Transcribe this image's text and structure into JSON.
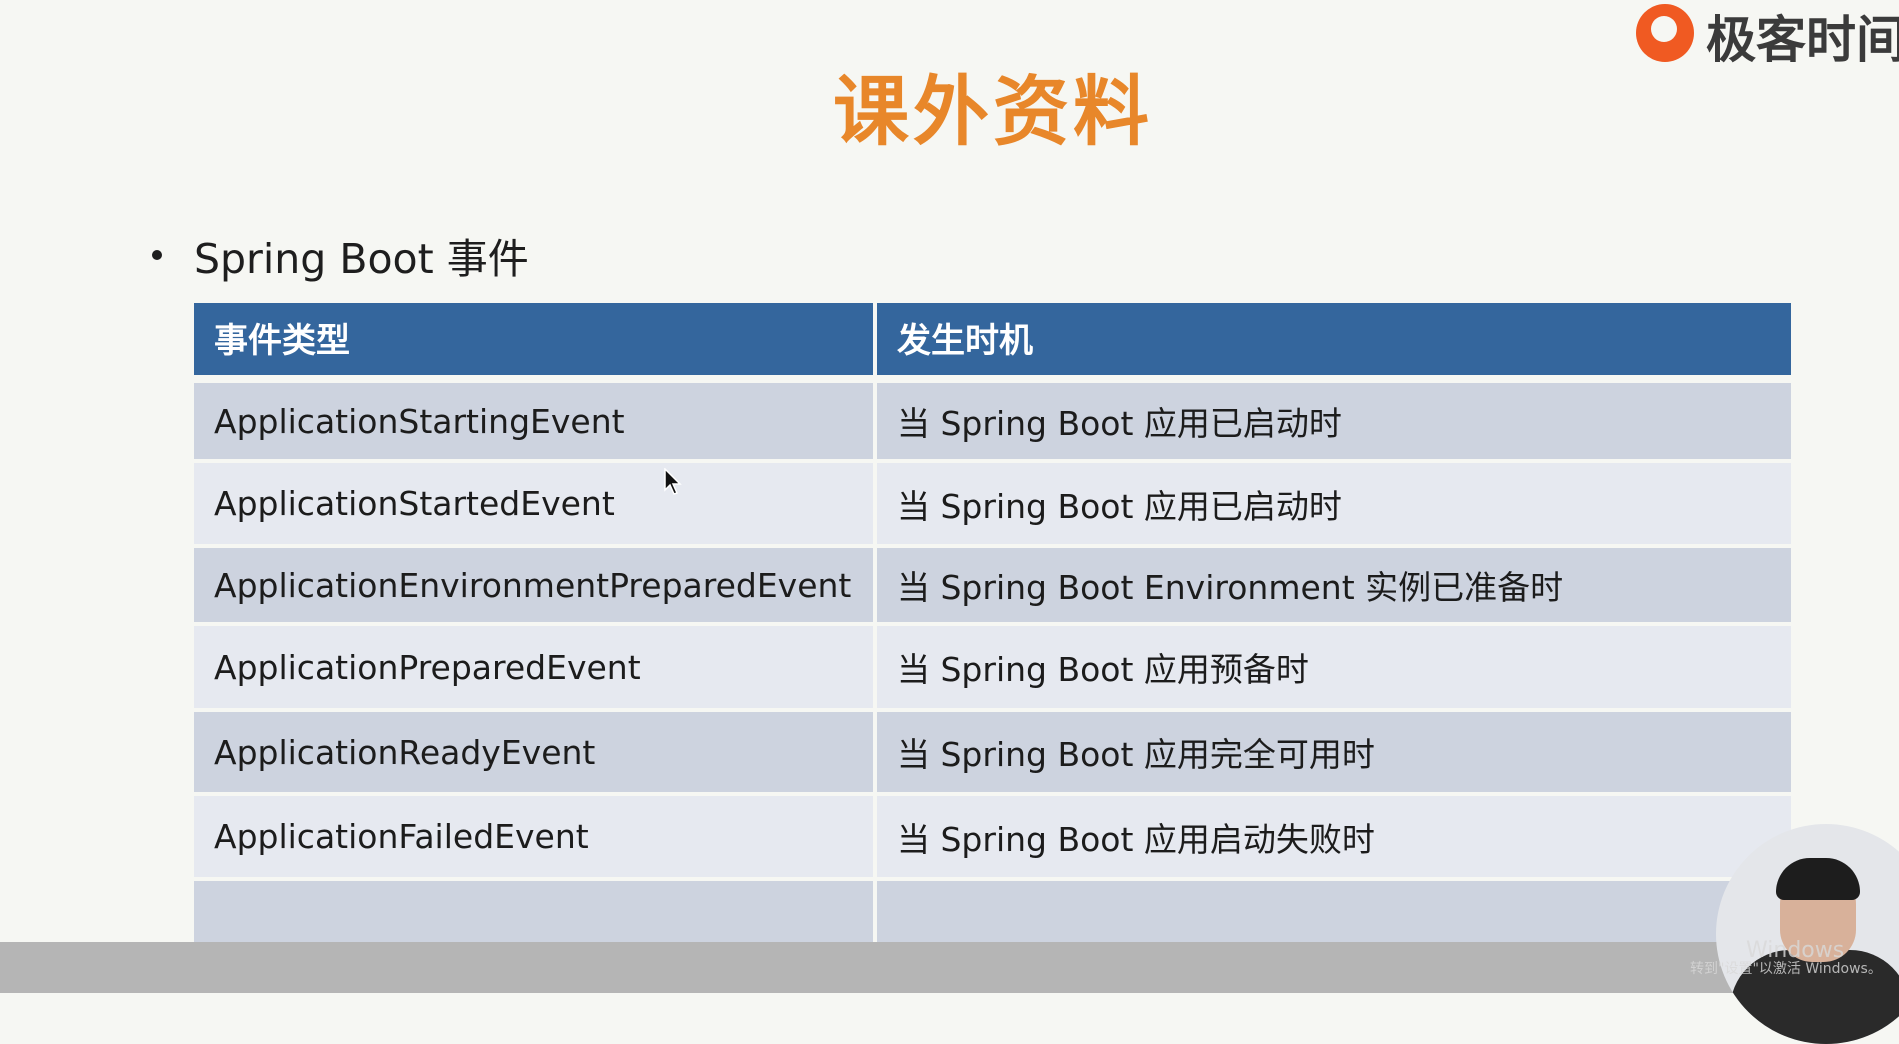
{
  "brand": {
    "logo_text": "极客时间"
  },
  "slide": {
    "title": "课外资料",
    "bullet": "Spring Boot 事件"
  },
  "table": {
    "headers": [
      "事件类型",
      "发生时机"
    ],
    "rows": [
      [
        "ApplicationStartingEvent",
        "当 Spring Boot 应用已启动时"
      ],
      [
        "ApplicationStartedEvent",
        "当 Spring Boot 应用已启动时"
      ],
      [
        "ApplicationEnvironmentPreparedEvent",
        "当 Spring Boot Environment 实例已准备时"
      ],
      [
        "ApplicationPreparedEvent",
        "当 Spring Boot 应用预备时"
      ],
      [
        "ApplicationReadyEvent",
        "当 Spring Boot 应用完全可用时"
      ],
      [
        "ApplicationFailedEvent",
        "当 Spring Boot 应用启动失败时"
      ],
      [
        "",
        ""
      ]
    ]
  },
  "overlay": {
    "watermark_line1": "Windows",
    "watermark_line2": "转到\"设置\"以激活 Windows。"
  }
}
